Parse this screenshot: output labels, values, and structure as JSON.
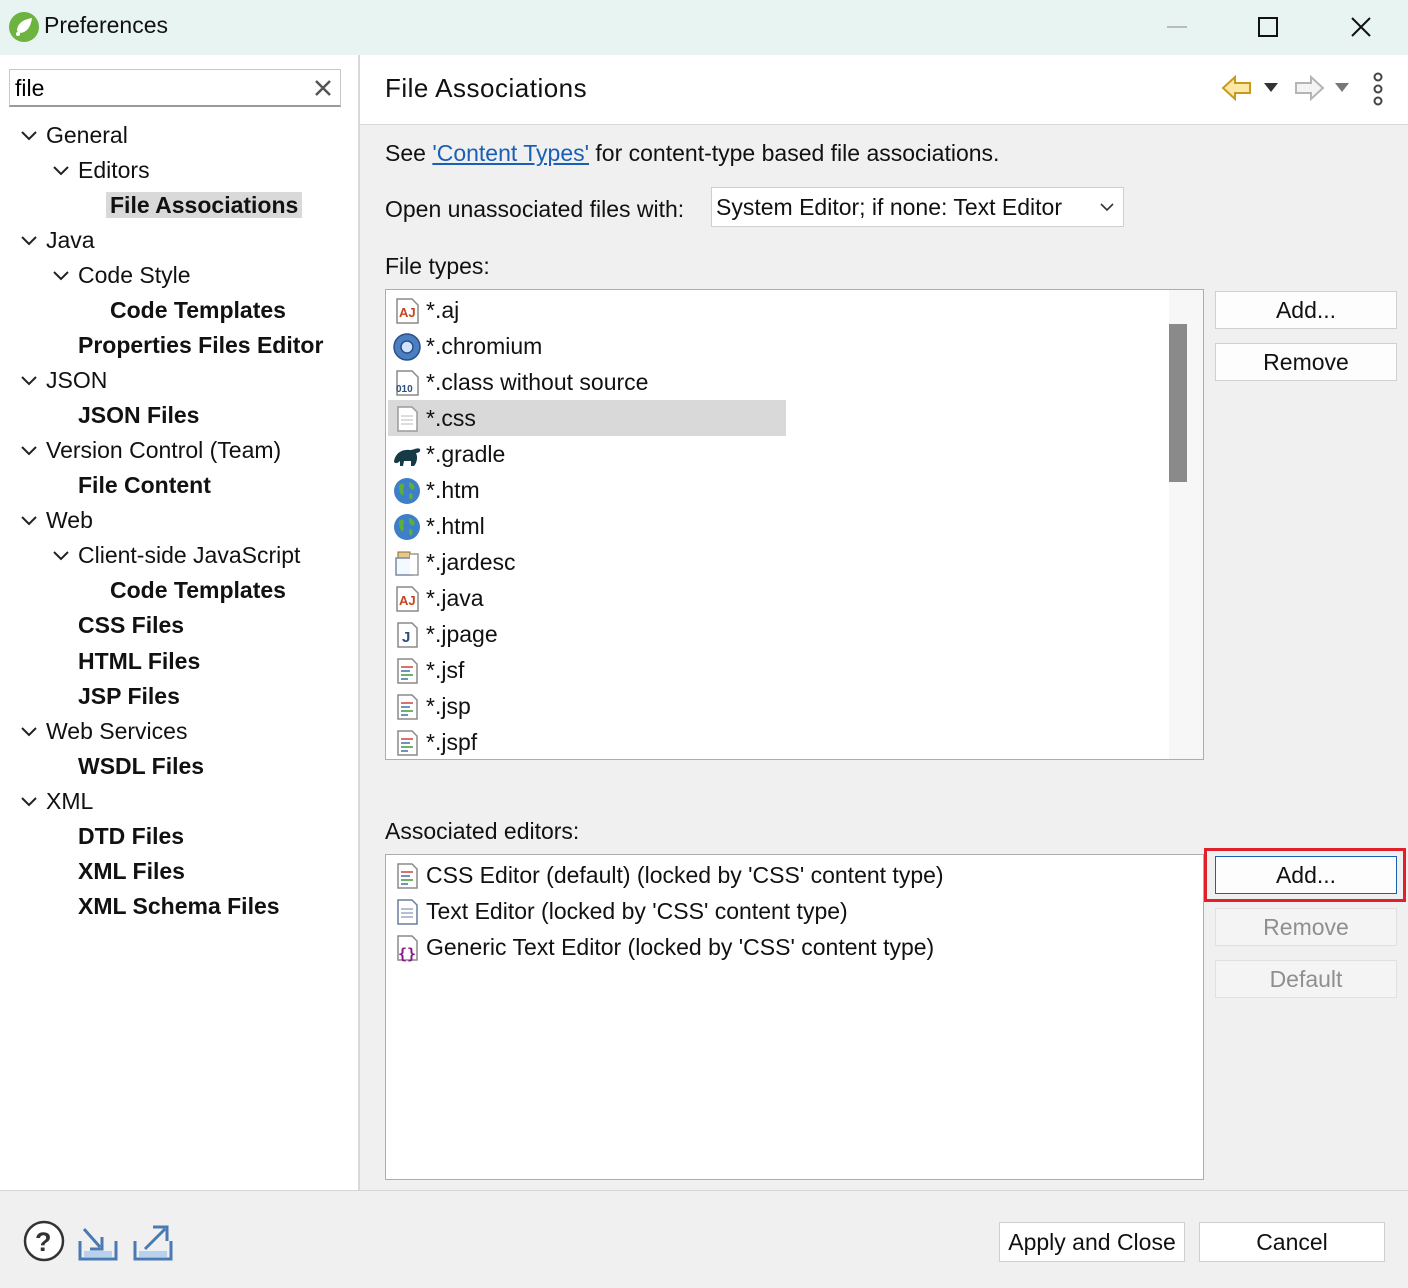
{
  "window": {
    "title": "Preferences"
  },
  "filter": {
    "value": "file"
  },
  "tree": [
    {
      "label": "General",
      "bold": false,
      "expanded": true
    },
    {
      "label": "Editors",
      "bold": false,
      "expanded": true
    },
    {
      "label": "File Associations",
      "bold": true,
      "selected": true
    },
    {
      "label": "Java",
      "bold": false,
      "expanded": true
    },
    {
      "label": "Code Style",
      "bold": false,
      "expanded": true
    },
    {
      "label": "Code Templates",
      "bold": true
    },
    {
      "label": "Properties Files Editor",
      "bold": true
    },
    {
      "label": "JSON",
      "bold": false,
      "expanded": true
    },
    {
      "label": "JSON Files",
      "bold": true
    },
    {
      "label": "Version Control (Team)",
      "bold": false,
      "expanded": true
    },
    {
      "label": "File Content",
      "bold": true
    },
    {
      "label": "Web",
      "bold": false,
      "expanded": true
    },
    {
      "label": "Client-side JavaScript",
      "bold": false,
      "expanded": true
    },
    {
      "label": "Code Templates",
      "bold": true
    },
    {
      "label": "CSS Files",
      "bold": true
    },
    {
      "label": "HTML Files",
      "bold": true
    },
    {
      "label": "JSP Files",
      "bold": true
    },
    {
      "label": "Web Services",
      "bold": false,
      "expanded": true
    },
    {
      "label": "WSDL Files",
      "bold": true
    },
    {
      "label": "XML",
      "bold": false,
      "expanded": true
    },
    {
      "label": "DTD Files",
      "bold": true
    },
    {
      "label": "XML Files",
      "bold": true
    },
    {
      "label": "XML Schema Files",
      "bold": true
    }
  ],
  "page": {
    "title": "File Associations",
    "see_prefix": "See",
    "see_link": "'Content Types'",
    "see_suffix": "for content-type based file associations.",
    "open_label": "Open unassociated files with:",
    "open_value": "System Editor; if none: Text Editor",
    "file_types_label": "File types:",
    "associated_label": "Associated editors:"
  },
  "file_types": [
    {
      "label": "*.aj",
      "icon": "aspectj-icon"
    },
    {
      "label": "*.chromium",
      "icon": "chromium-icon"
    },
    {
      "label": "*.class without source",
      "icon": "class-file-icon"
    },
    {
      "label": "*.css",
      "icon": "text-file-icon",
      "selected": true
    },
    {
      "label": "*.gradle",
      "icon": "gradle-icon"
    },
    {
      "label": "*.htm",
      "icon": "globe-icon"
    },
    {
      "label": "*.html",
      "icon": "globe-icon"
    },
    {
      "label": "*.jardesc",
      "icon": "jar-icon"
    },
    {
      "label": "*.java",
      "icon": "aspectj-icon"
    },
    {
      "label": "*.jpage",
      "icon": "java-file-icon"
    },
    {
      "label": "*.jsf",
      "icon": "web-file-icon"
    },
    {
      "label": "*.jsp",
      "icon": "web-file-icon"
    },
    {
      "label": "*.jspf",
      "icon": "web-file-icon"
    }
  ],
  "file_types_buttons": {
    "add": "Add...",
    "remove": "Remove"
  },
  "associated_editors": [
    {
      "label": "CSS Editor (default) (locked by 'CSS' content type)",
      "icon": "web-file-icon"
    },
    {
      "label": "Text Editor (locked by 'CSS' content type)",
      "icon": "text-file-icon"
    },
    {
      "label": "Generic Text Editor (locked by 'CSS' content type)",
      "icon": "generic-editor-icon"
    }
  ],
  "editor_buttons": {
    "add": "Add...",
    "remove": "Remove",
    "default": "Default"
  },
  "bottom": {
    "apply_close": "Apply and Close",
    "cancel": "Cancel"
  },
  "colors": {
    "highlight": "#e0202a",
    "link": "#1a5fb4",
    "selection": "#d9d9d9"
  }
}
